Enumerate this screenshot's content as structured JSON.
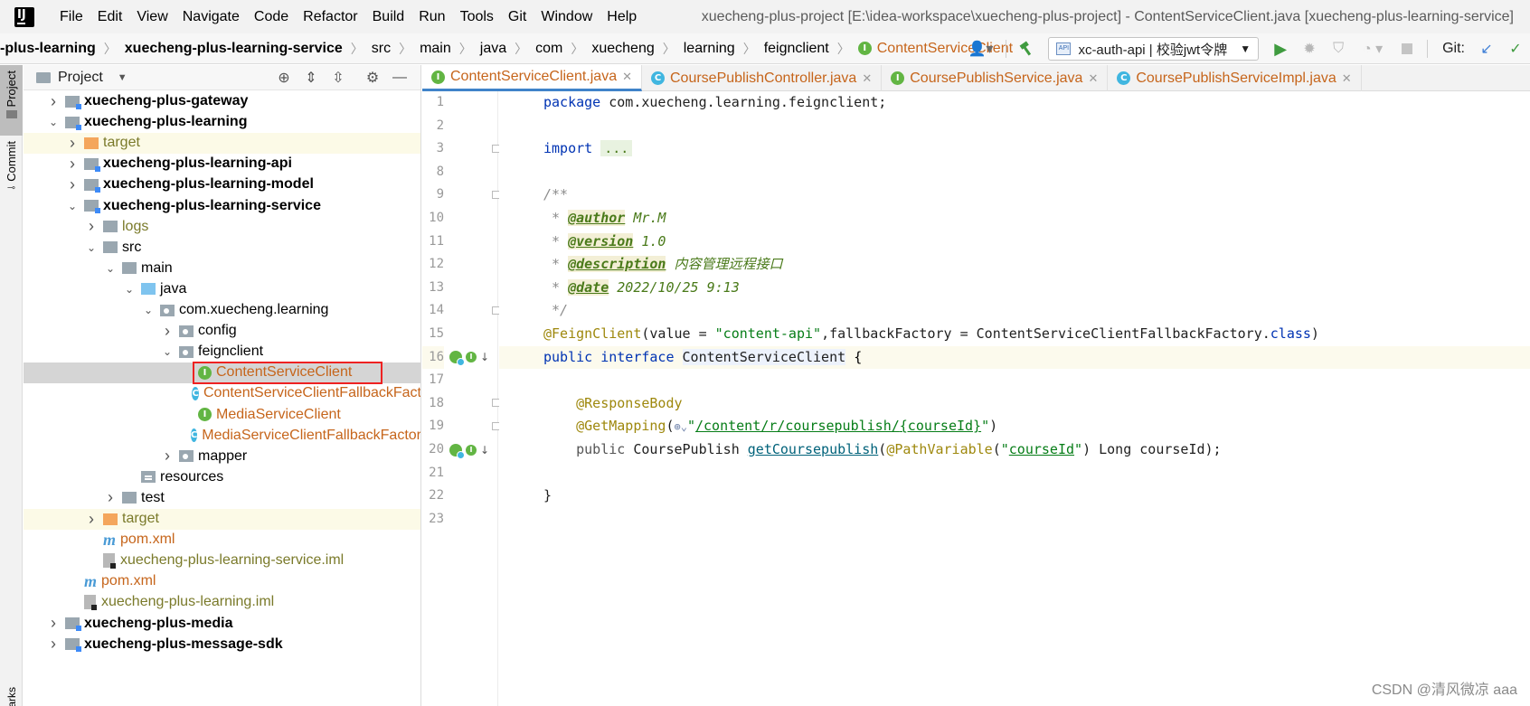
{
  "menubar": {
    "logo": "IJ",
    "items": [
      "File",
      "Edit",
      "View",
      "Navigate",
      "Code",
      "Refactor",
      "Build",
      "Run",
      "Tools",
      "Git",
      "Window",
      "Help"
    ],
    "window_title": "xuecheng-plus-project [E:\\idea-workspace\\xuecheng-plus-project] - ContentServiceClient.java [xuecheng-plus-learning-service]"
  },
  "breadcrumb": {
    "items": [
      "-plus-learning",
      "xuecheng-plus-learning-service",
      "src",
      "main",
      "java",
      "com",
      "xuecheng",
      "learning",
      "feignclient"
    ],
    "current": "ContentServiceClient",
    "current_icon": "I"
  },
  "toolbar": {
    "run_config": "xc-auth-api | 校验jwt令牌",
    "git_label": "Git:",
    "icons": [
      "user-icon",
      "build-hammer-icon",
      "run-icon",
      "debug-icon",
      "coverage-icon",
      "profile-icon",
      "stop-icon",
      "git-update-icon",
      "git-commit-icon"
    ]
  },
  "toolstrip": {
    "project_tab": "Project",
    "commit_tab": "Commit",
    "bookmarks_tab": "arks"
  },
  "project_panel": {
    "title": "Project",
    "tree": [
      {
        "label": "xuecheng-plus-gateway",
        "depth": 1,
        "arrow": "right",
        "icon": "module",
        "style": "bold"
      },
      {
        "label": "xuecheng-plus-learning",
        "depth": 1,
        "arrow": "down",
        "icon": "module",
        "style": "bold"
      },
      {
        "label": "target",
        "depth": 2,
        "arrow": "right",
        "icon": "folder-orange",
        "style": "olive",
        "highlight": "yellow"
      },
      {
        "label": "xuecheng-plus-learning-api",
        "depth": 2,
        "arrow": "right",
        "icon": "module",
        "style": "bold"
      },
      {
        "label": "xuecheng-plus-learning-model",
        "depth": 2,
        "arrow": "right",
        "icon": "module",
        "style": "bold"
      },
      {
        "label": "xuecheng-plus-learning-service",
        "depth": 2,
        "arrow": "down",
        "icon": "module",
        "style": "bold"
      },
      {
        "label": "logs",
        "depth": 3,
        "arrow": "right",
        "icon": "folder",
        "style": "olive"
      },
      {
        "label": "src",
        "depth": 3,
        "arrow": "down",
        "icon": "folder",
        "style": "normal"
      },
      {
        "label": "main",
        "depth": 4,
        "arrow": "down",
        "icon": "folder",
        "style": "normal"
      },
      {
        "label": "java",
        "depth": 5,
        "arrow": "down",
        "icon": "folder-blue",
        "style": "normal"
      },
      {
        "label": "com.xuecheng.learning",
        "depth": 6,
        "arrow": "down",
        "icon": "package",
        "style": "normal"
      },
      {
        "label": "config",
        "depth": 7,
        "arrow": "right",
        "icon": "package",
        "style": "normal"
      },
      {
        "label": "feignclient",
        "depth": 7,
        "arrow": "down",
        "icon": "package",
        "style": "normal"
      },
      {
        "label": "ContentServiceClient",
        "depth": 8,
        "arrow": "none",
        "icon": "interface",
        "style": "orange",
        "highlight": "selected"
      },
      {
        "label": "ContentServiceClientFallbackFact",
        "depth": 8,
        "arrow": "none",
        "icon": "class",
        "style": "orange"
      },
      {
        "label": "MediaServiceClient",
        "depth": 8,
        "arrow": "none",
        "icon": "interface",
        "style": "orange"
      },
      {
        "label": "MediaServiceClientFallbackFactor",
        "depth": 8,
        "arrow": "none",
        "icon": "class",
        "style": "orange"
      },
      {
        "label": "mapper",
        "depth": 7,
        "arrow": "right",
        "icon": "package",
        "style": "normal"
      },
      {
        "label": "resources",
        "depth": 5,
        "arrow": "none",
        "icon": "resources",
        "style": "normal"
      },
      {
        "label": "test",
        "depth": 4,
        "arrow": "right",
        "icon": "folder",
        "style": "normal"
      },
      {
        "label": "target",
        "depth": 3,
        "arrow": "right",
        "icon": "folder-orange",
        "style": "olive",
        "highlight": "yellow"
      },
      {
        "label": "pom.xml",
        "depth": 3,
        "arrow": "none",
        "icon": "maven",
        "style": "orange"
      },
      {
        "label": "xuecheng-plus-learning-service.iml",
        "depth": 3,
        "arrow": "none",
        "icon": "iml",
        "style": "olive"
      },
      {
        "label": "pom.xml",
        "depth": 2,
        "arrow": "none",
        "icon": "maven",
        "style": "orange"
      },
      {
        "label": "xuecheng-plus-learning.iml",
        "depth": 2,
        "arrow": "none",
        "icon": "iml",
        "style": "olive"
      },
      {
        "label": "xuecheng-plus-media",
        "depth": 1,
        "arrow": "right",
        "icon": "module",
        "style": "bold"
      },
      {
        "label": "xuecheng-plus-message-sdk",
        "depth": 1,
        "arrow": "right",
        "icon": "module",
        "style": "bold"
      }
    ]
  },
  "editor_tabs": [
    {
      "name": "ContentServiceClient.java",
      "icon": "I",
      "active": true
    },
    {
      "name": "CoursePublishController.java",
      "icon": "C",
      "active": false
    },
    {
      "name": "CoursePublishService.java",
      "icon": "I",
      "active": false
    },
    {
      "name": "CoursePublishServiceImpl.java",
      "icon": "C",
      "active": false
    }
  ],
  "code": {
    "line_numbers": [
      "1",
      "2",
      "3",
      "8",
      "9",
      "10",
      "11",
      "12",
      "13",
      "14",
      "15",
      "16",
      "17",
      "18",
      "19",
      "20",
      "21",
      "22",
      "23"
    ],
    "current_line": "16",
    "pkg_kw": "package",
    "pkg_name": " com.xuecheng.learning.feignclient;",
    "import_kw": "import",
    "import_fold": "...",
    "doc_open": "/**",
    "doc_star": " * ",
    "author_tag": "@author",
    "author_val": " Mr.M",
    "version_tag": "@version",
    "version_val": " 1.0",
    "desc_tag": "@description",
    "desc_val": " 内容管理远程接口",
    "date_tag": "@date",
    "date_val": " 2022/10/25 9:13",
    "doc_close": " */",
    "feign_ann": "@FeignClient",
    "feign_args_1": "(value = ",
    "feign_str": "\"content-api\"",
    "feign_args_2": ",fallbackFactory = ContentServiceClientFallbackFactory.",
    "feign_class_kw": "class",
    "feign_close": ")",
    "public_kw": "public",
    "interface_kw": "interface",
    "iface_name": "ContentServiceClient",
    "open_brace": "{",
    "resp_ann": "@ResponseBody",
    "get_ann": "@GetMapping",
    "get_paren": "(",
    "get_str_q1": "\"",
    "get_str_path": "/content/r/coursepublish/",
    "get_str_var": "{courseId}",
    "get_str_q2": "\"",
    "get_close": ")",
    "method_public": "public",
    "method_ret": " CoursePublish ",
    "method_name": "getCoursepublish",
    "method_paren": "(",
    "path_var_ann": "@PathVariable",
    "path_var_paren": "(",
    "path_var_str_q1": "\"",
    "path_var_str": "courseId",
    "path_var_str_q2": "\"",
    "method_tail": ") Long courseId);",
    "close_brace": "}"
  },
  "watermark": "CSDN @清风微凉 aaa"
}
